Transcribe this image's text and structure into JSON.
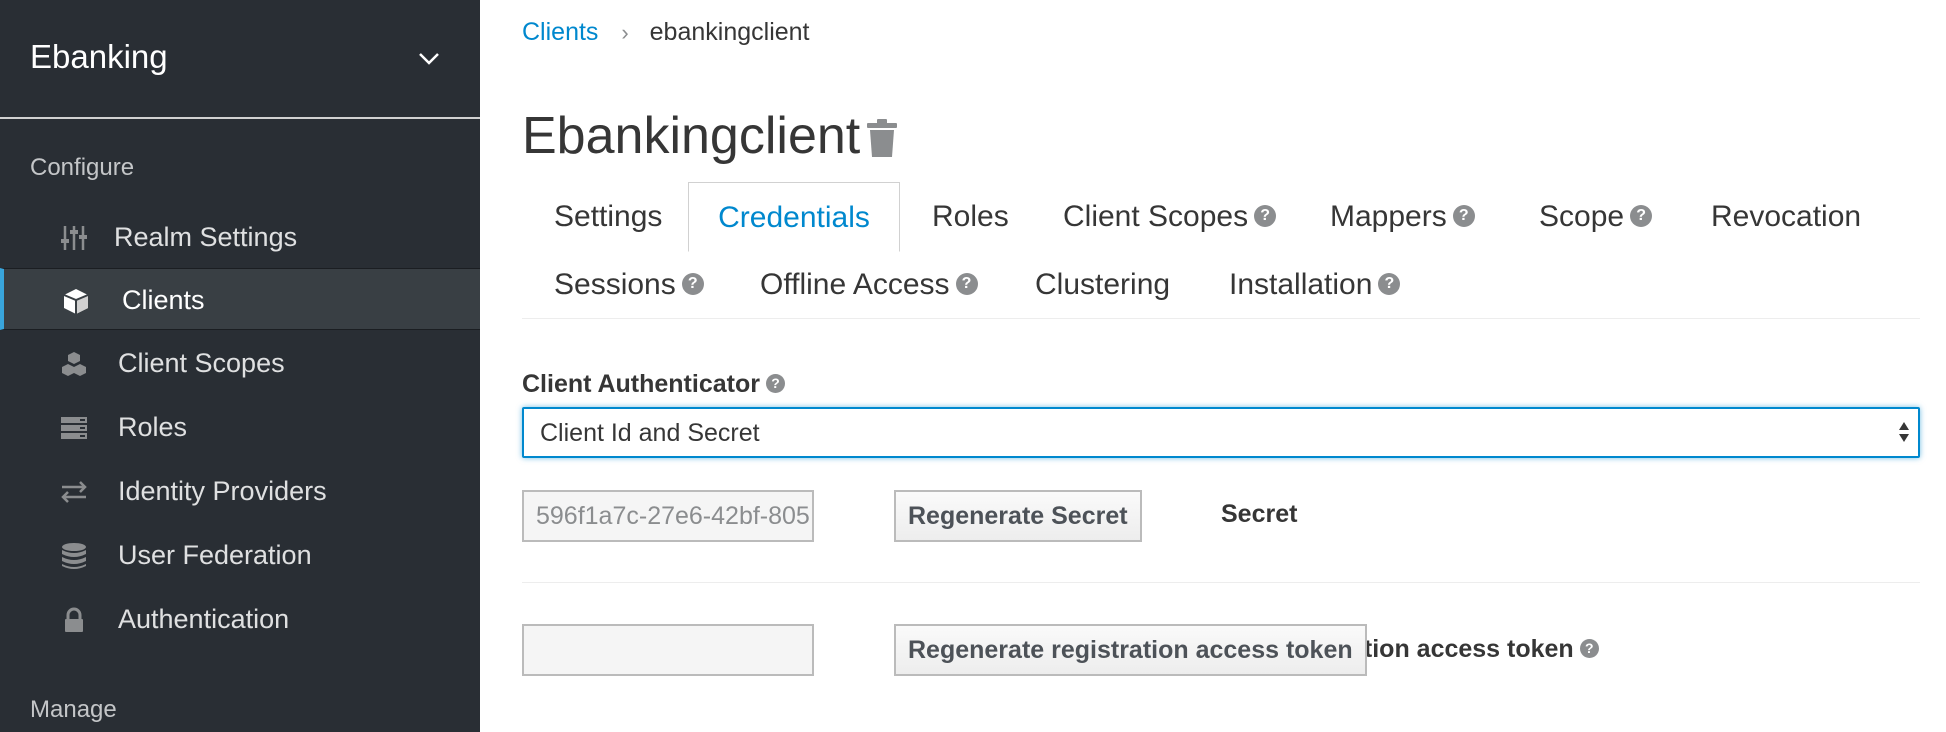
{
  "sidebar": {
    "realm_name": "Ebanking",
    "sections": {
      "configure": "Configure",
      "manage": "Manage"
    },
    "items": [
      {
        "label": "Realm Settings",
        "icon": "sliders-icon",
        "active": false
      },
      {
        "label": "Clients",
        "icon": "cube-icon",
        "active": true
      },
      {
        "label": "Client Scopes",
        "icon": "cubes-icon",
        "active": false
      },
      {
        "label": "Roles",
        "icon": "list-icon",
        "active": false
      },
      {
        "label": "Identity Providers",
        "icon": "exchange-icon",
        "active": false
      },
      {
        "label": "User Federation",
        "icon": "database-icon",
        "active": false
      },
      {
        "label": "Authentication",
        "icon": "lock-icon",
        "active": false
      }
    ]
  },
  "breadcrumb": {
    "parent": "Clients",
    "separator": "›",
    "current": "ebankingclient"
  },
  "page": {
    "title": "Ebankingclient",
    "title_icon": "trash-icon"
  },
  "tabs": [
    {
      "label": "Settings",
      "help": false,
      "active": false
    },
    {
      "label": "Credentials",
      "help": false,
      "active": true
    },
    {
      "label": "Roles",
      "help": false,
      "active": false
    },
    {
      "label": "Client Scopes",
      "help": true,
      "active": false
    },
    {
      "label": "Mappers",
      "help": true,
      "active": false
    },
    {
      "label": "Scope",
      "help": true,
      "active": false
    },
    {
      "label": "Revocation",
      "help": false,
      "active": false
    },
    {
      "label": "Sessions",
      "help": true,
      "active": false
    },
    {
      "label": "Offline Access",
      "help": true,
      "active": false
    },
    {
      "label": "Clustering",
      "help": false,
      "active": false
    },
    {
      "label": "Installation",
      "help": true,
      "active": false
    }
  ],
  "form": {
    "authenticator_label": "Client Authenticator",
    "authenticator_value": "Client Id and Secret",
    "secret": {
      "value": "596f1a7c-27e6-42bf-805",
      "button": "Regenerate Secret",
      "label": "Secret"
    },
    "registration": {
      "value": "",
      "button": "Regenerate registration access token",
      "label": "ation access token"
    }
  },
  "colors": {
    "accent": "#0088ce",
    "sidebar_bg": "#292e34",
    "active_item_bg": "#393f44"
  }
}
